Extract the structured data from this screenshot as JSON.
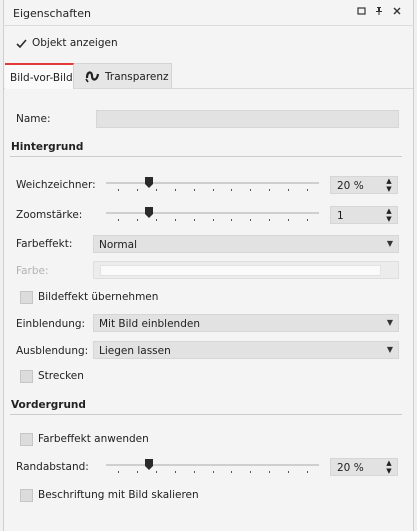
{
  "window": {
    "title": "Eigenschaften",
    "icons": [
      "window-restore-icon",
      "pin-icon",
      "close-icon"
    ]
  },
  "header": {
    "show_object_label": "Objekt anzeigen",
    "show_object_checked": true
  },
  "tabs": [
    {
      "label": "Bild-vor-Bild",
      "active": true
    },
    {
      "label": "Transparenz",
      "active": false,
      "icon": "transparency-icon"
    }
  ],
  "fields": {
    "name_label": "Name:",
    "name_value": ""
  },
  "background_section": {
    "title": "Hintergrund",
    "blur_label": "Weichzeichner:",
    "blur_value": "20 %",
    "blur_level": 0.2,
    "zoom_label": "Zoomstärke:",
    "zoom_value": "1",
    "zoom_level": 0.2,
    "color_effect_label": "Farbeffekt:",
    "color_effect_value": "Normal",
    "color_label": "Farbe:",
    "inherit_effect_label": "Bildeffekt übernehmen",
    "fade_in_label": "Einblendung:",
    "fade_in_value": "Mit Bild einblenden",
    "fade_out_label": "Ausblendung:",
    "fade_out_value": "Liegen lassen",
    "stretch_label": "Strecken"
  },
  "foreground_section": {
    "title": "Vordergrund",
    "apply_color_effect_label": "Farbeffekt anwenden",
    "margin_label": "Randabstand:",
    "margin_value": "20 %",
    "margin_level": 0.2,
    "scale_caption_label": "Beschriftung mit Bild skalieren"
  },
  "colors": {
    "accent": "#e03a3a",
    "panel_bg": "#f4f4f4",
    "field_bg": "#e2e2e2"
  }
}
